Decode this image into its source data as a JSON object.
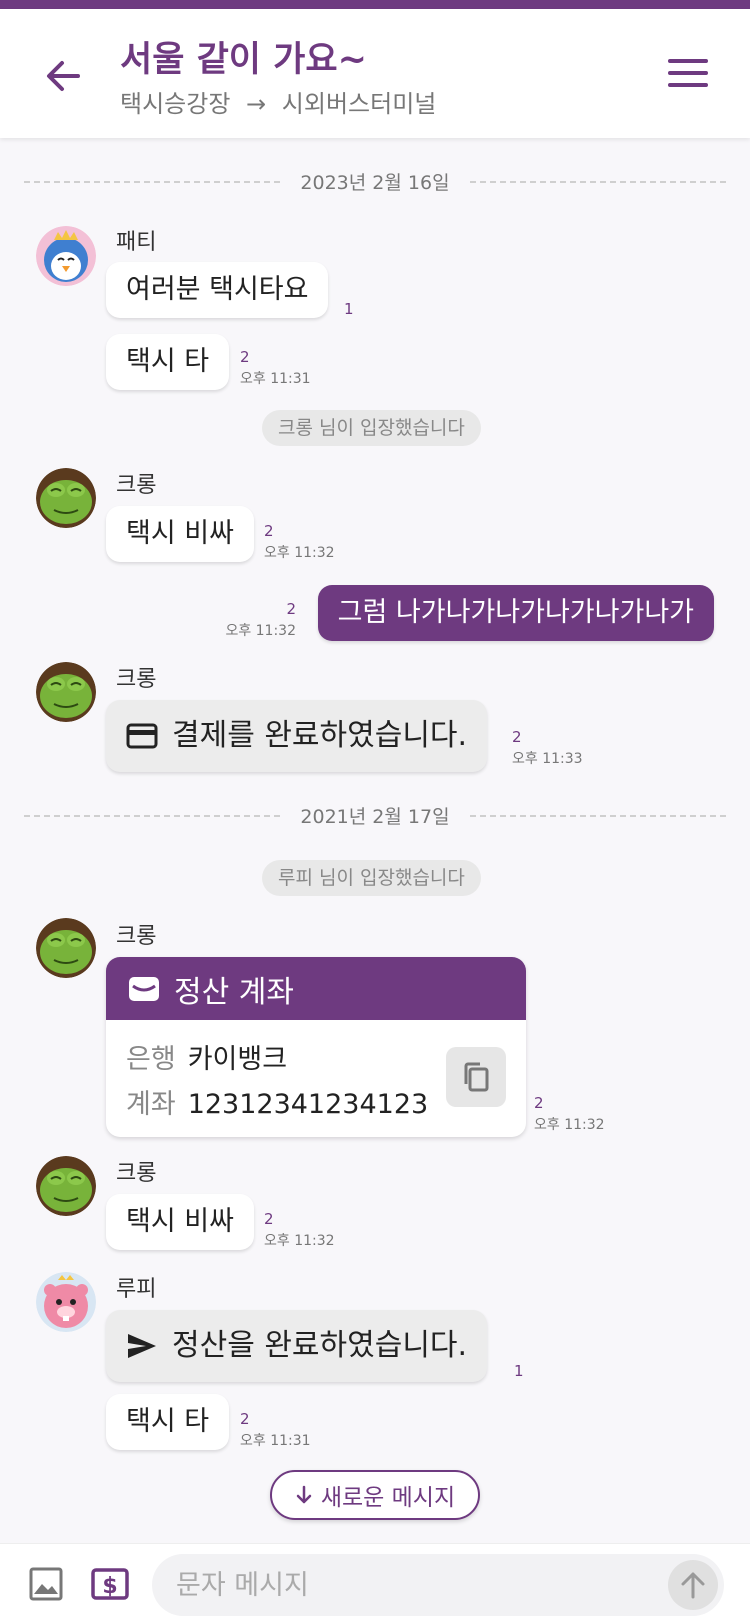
{
  "header": {
    "title": "서울 같이 가요~",
    "route_from": "택시승강장",
    "route_arrow": "→",
    "route_to": "시외버스터미널"
  },
  "colors": {
    "accent": "#6e3a80",
    "bubble_gray": "#ececec"
  },
  "dates": [
    "2023년 2월 16일",
    "2021년 2월 17일"
  ],
  "system_messages": [
    "크롱 님이 입장했습니다",
    "루피 님이 입장했습니다"
  ],
  "senders": {
    "patty": "패티",
    "crong": "크롱",
    "loopy": "루피"
  },
  "messages": [
    {
      "text": "여러분 택시타요",
      "count": "1",
      "time": ""
    },
    {
      "text": "택시 타",
      "count": "2",
      "time": "오후 11:31"
    },
    {
      "text": "택시 비싸",
      "count": "2",
      "time": "오후 11:32"
    },
    {
      "text": "그럼 나가나가나가나가나가나가",
      "count": "2",
      "time": "오후 11:32"
    },
    {
      "text": "결제를 완료하였습니다.",
      "count": "2",
      "time": "오후 11:33",
      "icon": "credit-card-icon"
    },
    {
      "text": "택시 비싸",
      "count": "2",
      "time": "오후 11:32"
    },
    {
      "text": "정산을 완료하였습니다.",
      "count": "1",
      "time": "",
      "icon": "send-icon"
    },
    {
      "text": "택시 타",
      "count": "2",
      "time": "오후 11:31"
    }
  ],
  "account_card": {
    "title": "정산 계좌",
    "bank_label": "은행",
    "bank_value": "카이뱅크",
    "account_label": "계좌",
    "account_value": "12312341234123",
    "count": "2",
    "time": "오후 11:32"
  },
  "new_message_button": "새로운 메시지",
  "composer": {
    "placeholder": "문자 메시지"
  }
}
